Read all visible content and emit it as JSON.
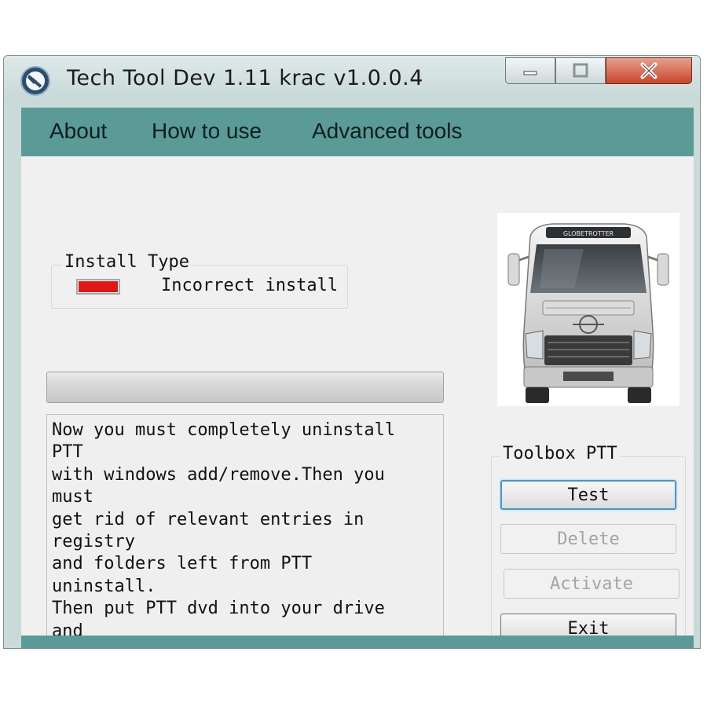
{
  "window": {
    "title": "Tech Tool Dev  1.11  krac  v1.0.0.4",
    "icon": "app-logo-icon",
    "controls": [
      "minimize-icon",
      "maximize-icon",
      "close-icon"
    ]
  },
  "menu": {
    "items": [
      {
        "label": "About"
      },
      {
        "label": "How to use"
      },
      {
        "label": "Advanced tools"
      }
    ],
    "background": "#5a9a97"
  },
  "install_type": {
    "legend": "Install Type",
    "status_text": "Incorrect install",
    "status_color": "#e01717"
  },
  "progress": {
    "value": 0
  },
  "message_lines": [
    "Now you must completely uninstall",
    "PTT",
    "with windows add/remove.Then you",
    "must",
    "get rid of relevant entries in",
    "registry",
    "and folders left from PTT",
    "uninstall.",
    "Then put PTT dvd into your drive",
    "and"
  ],
  "image": {
    "subject": "truck-image",
    "banner": "GLOBETROTTER"
  },
  "toolbox": {
    "legend": "Toolbox  PTT",
    "buttons": {
      "test": "Test",
      "delete": "Delete",
      "activate": "Activate",
      "exit": "Exit"
    }
  }
}
